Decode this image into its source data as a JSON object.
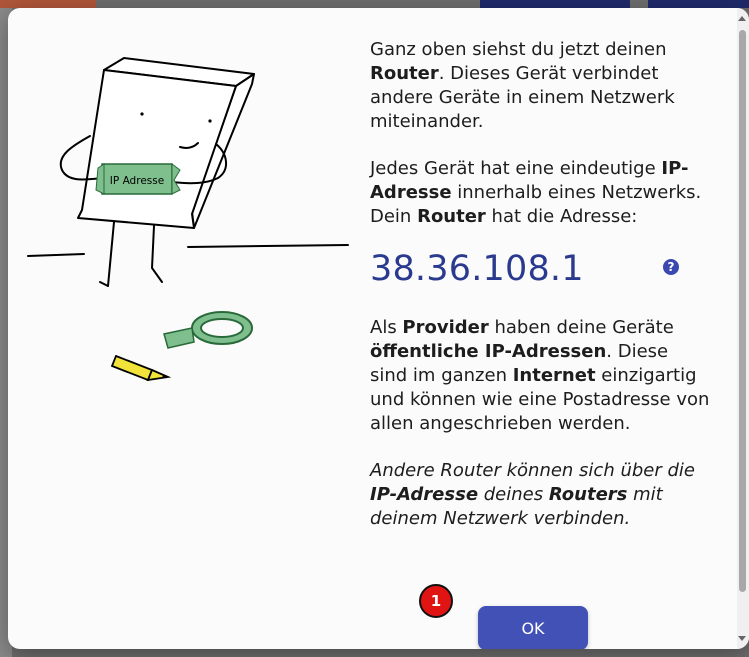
{
  "illustration": {
    "sign_label": "IP Adresse"
  },
  "dialog": {
    "paragraph1": {
      "t1": "Ganz oben siehst du jetzt deinen ",
      "b1": "Router",
      "t2": ". Dieses Gerät verbindet andere Geräte in einem Netzwerk miteinander."
    },
    "paragraph2": {
      "t1": "Jedes Gerät hat eine eindeutige ",
      "b1": "IP-Adresse",
      "t2": " innerhalb eines Netzwerks. Dein ",
      "b2": "Router",
      "t3": " hat die Adresse:"
    },
    "ip_address": "38.36.108.1",
    "help_icon_glyph": "?",
    "paragraph3": {
      "t1": "Als ",
      "b1": "Provider",
      "t2": " haben deine Geräte ",
      "b2": "öffentliche IP-Adressen",
      "t3": ". Diese sind im ganzen ",
      "b3": "Internet",
      "t4": " einzigartig und können wie eine Postadresse von allen angeschrieben werden."
    },
    "paragraph4": {
      "t1": "Andere Router können sich über die ",
      "b1": "IP-Adresse",
      "t2": " deines ",
      "b2": "Routers",
      "t3": " mit deinem Netzwerk verbinden."
    },
    "ok_label": "OK",
    "badge_number": "1"
  },
  "colors": {
    "ip_text": "#2a3a8f",
    "button": "#4251b6",
    "badge": "#e11414",
    "sign_green": "#7fbf8e",
    "pencil_yellow": "#f2e33a"
  },
  "icons": {
    "help": "question-circle-icon"
  }
}
